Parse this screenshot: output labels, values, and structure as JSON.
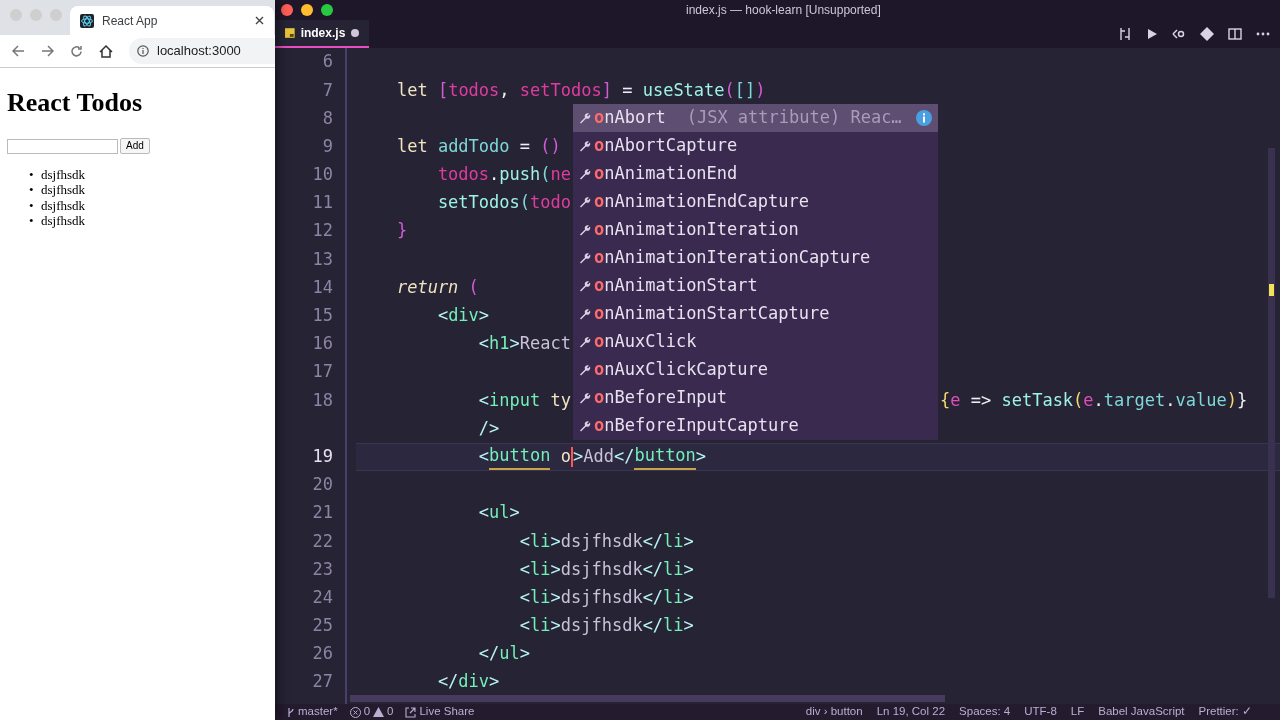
{
  "browser": {
    "tab": {
      "title": "React App"
    },
    "address": "localhost:3000",
    "page": {
      "heading": "React Todos",
      "add_button": "Add",
      "items": [
        {
          "marker": "•",
          "text": "dsjfhsdk"
        },
        {
          "marker": "•",
          "text": "dsjfhsdk"
        },
        {
          "marker": "•",
          "text": "dsjfhsdk"
        },
        {
          "marker": "•",
          "text": "dsjfhsdk"
        }
      ]
    }
  },
  "editor": {
    "title": "index.js — hook-learn [Unsupported]",
    "tabs": [
      {
        "label": "index.js",
        "selected": true,
        "dirty": true
      }
    ],
    "lines": [
      {
        "num": "6",
        "current": false
      },
      {
        "num": "7",
        "current": false,
        "tokens": [
          {
            "kind": "kw",
            "s": "    let "
          },
          {
            "kind": "br",
            "s": "["
          },
          {
            "kind": "var",
            "s": "todos"
          },
          {
            "kind": "op",
            "s": ", "
          },
          {
            "kind": "var",
            "s": "setTodos"
          },
          {
            "kind": "br",
            "s": "]"
          },
          {
            "kind": "op",
            "s": " = "
          },
          {
            "kind": "fn",
            "s": "useState"
          },
          {
            "kind": "br",
            "s": "("
          },
          {
            "kind": "prop",
            "s": "[]"
          },
          {
            "kind": "br",
            "s": ")"
          }
        ]
      },
      {
        "num": "8",
        "current": false
      },
      {
        "num": "9",
        "current": false,
        "tokens": [
          {
            "kind": "kw",
            "s": "    let "
          },
          {
            "kind": "prop",
            "s": "addTodo"
          },
          {
            "kind": "op",
            "s": " = "
          },
          {
            "kind": "br",
            "s": "()"
          }
        ]
      },
      {
        "num": "10",
        "current": false,
        "tokens": [
          {
            "kind": "var",
            "s": "        todos"
          },
          {
            "kind": "op",
            "s": "."
          },
          {
            "kind": "fn",
            "s": "push"
          },
          {
            "kind": "prop",
            "s": "("
          },
          {
            "kind": "var",
            "s": "ne"
          }
        ]
      },
      {
        "num": "11",
        "current": false,
        "tokens": [
          {
            "kind": "fn",
            "s": "        setTodos"
          },
          {
            "kind": "prop",
            "s": "("
          },
          {
            "kind": "var",
            "s": "todo"
          }
        ]
      },
      {
        "num": "12",
        "current": false,
        "tokens": [
          {
            "kind": "br",
            "s": "    }"
          }
        ]
      },
      {
        "num": "13",
        "current": false
      },
      {
        "num": "14",
        "current": false,
        "tokens": [
          {
            "kind": "ret",
            "s": "    return "
          },
          {
            "kind": "br",
            "s": "("
          }
        ]
      },
      {
        "num": "15",
        "current": false,
        "tokens": [
          {
            "kind": "tp",
            "s": "        <"
          },
          {
            "kind": "tag",
            "s": "div"
          },
          {
            "kind": "tp",
            "s": ">"
          }
        ]
      },
      {
        "num": "16",
        "current": false,
        "tokens": [
          {
            "kind": "tp",
            "s": "            <"
          },
          {
            "kind": "tag",
            "s": "h1"
          },
          {
            "kind": "tp",
            "s": ">"
          },
          {
            "kind": "text",
            "s": "React"
          }
        ]
      },
      {
        "num": "17",
        "current": false
      },
      {
        "num": "18",
        "current": false,
        "tokens": [
          {
            "kind": "tp",
            "s": "            <"
          },
          {
            "kind": "tag",
            "s": "input"
          },
          {
            "kind": "kw",
            "s": " ty"
          }
        ],
        "after": [
          {
            "kind": "ye",
            "s": "{"
          },
          {
            "kind": "par",
            "s": "e"
          },
          {
            "kind": "op",
            "s": " => "
          },
          {
            "kind": "fn",
            "s": "setTask"
          },
          {
            "kind": "ye",
            "s": "("
          },
          {
            "kind": "par",
            "s": "e"
          },
          {
            "kind": "op",
            "s": "."
          },
          {
            "kind": "prop",
            "s": "target"
          },
          {
            "kind": "op",
            "s": "."
          },
          {
            "kind": "prop",
            "s": "value"
          },
          {
            "kind": "ye",
            "s": ")"
          },
          {
            "kind": "op",
            "s": "}"
          }
        ]
      },
      {
        "current": false,
        "tokens": [
          {
            "kind": "tp",
            "s": "            />"
          }
        ]
      },
      {
        "num": "19",
        "current": true,
        "tokens": [
          {
            "kind": "tp",
            "s": "            <"
          },
          {
            "kind": "match",
            "s": "button"
          },
          {
            "kind": "kw",
            "s": " o"
          },
          {
            "kind": "cursor"
          },
          {
            "kind": "tp",
            "s": ">"
          },
          {
            "kind": "text",
            "s": "Add"
          },
          {
            "kind": "tp",
            "s": "</"
          },
          {
            "kind": "match",
            "s": "button"
          },
          {
            "kind": "tp",
            "s": ">"
          }
        ]
      },
      {
        "num": "20",
        "current": false
      },
      {
        "num": "21",
        "current": false,
        "tokens": [
          {
            "kind": "tp",
            "s": "            <"
          },
          {
            "kind": "tag",
            "s": "ul"
          },
          {
            "kind": "tp",
            "s": ">"
          }
        ]
      },
      {
        "num": "22",
        "current": false,
        "tokens": [
          {
            "kind": "tp",
            "s": "                <"
          },
          {
            "kind": "tag",
            "s": "li"
          },
          {
            "kind": "tp",
            "s": ">"
          },
          {
            "kind": "text",
            "s": "dsjfhsdk"
          },
          {
            "kind": "tp",
            "s": "</"
          },
          {
            "kind": "tag",
            "s": "li"
          },
          {
            "kind": "tp",
            "s": ">"
          }
        ]
      },
      {
        "num": "23",
        "current": false,
        "tokens": [
          {
            "kind": "tp",
            "s": "                <"
          },
          {
            "kind": "tag",
            "s": "li"
          },
          {
            "kind": "tp",
            "s": ">"
          },
          {
            "kind": "text",
            "s": "dsjfhsdk"
          },
          {
            "kind": "tp",
            "s": "</"
          },
          {
            "kind": "tag",
            "s": "li"
          },
          {
            "kind": "tp",
            "s": ">"
          }
        ]
      },
      {
        "num": "24",
        "current": false,
        "tokens": [
          {
            "kind": "tp",
            "s": "                <"
          },
          {
            "kind": "tag",
            "s": "li"
          },
          {
            "kind": "tp",
            "s": ">"
          },
          {
            "kind": "text",
            "s": "dsjfhsdk"
          },
          {
            "kind": "tp",
            "s": "</"
          },
          {
            "kind": "tag",
            "s": "li"
          },
          {
            "kind": "tp",
            "s": ">"
          }
        ]
      },
      {
        "num": "25",
        "current": false,
        "tokens": [
          {
            "kind": "tp",
            "s": "                <"
          },
          {
            "kind": "tag",
            "s": "li"
          },
          {
            "kind": "tp",
            "s": ">"
          },
          {
            "kind": "text",
            "s": "dsjfhsdk"
          },
          {
            "kind": "tp",
            "s": "</"
          },
          {
            "kind": "tag",
            "s": "li"
          },
          {
            "kind": "tp",
            "s": ">"
          }
        ]
      },
      {
        "num": "26",
        "current": false,
        "tokens": [
          {
            "kind": "tp",
            "s": "            </"
          },
          {
            "kind": "tag",
            "s": "ul"
          },
          {
            "kind": "tp",
            "s": ">"
          }
        ]
      },
      {
        "num": "27",
        "current": false,
        "tokens": [
          {
            "kind": "tp",
            "s": "        </"
          },
          {
            "kind": "tag",
            "s": "div"
          },
          {
            "kind": "tp",
            "s": ">"
          }
        ]
      }
    ],
    "suggestions": [
      {
        "match": "o",
        "rest": "nAbort",
        "detail": "(JSX attribute) Reac…",
        "selected": true
      },
      {
        "match": "o",
        "rest": "nAbortCapture",
        "selected": false
      },
      {
        "match": "o",
        "rest": "nAnimationEnd",
        "selected": false
      },
      {
        "match": "o",
        "rest": "nAnimationEndCapture",
        "selected": false
      },
      {
        "match": "o",
        "rest": "nAnimationIteration",
        "selected": false
      },
      {
        "match": "o",
        "rest": "nAnimationIterationCapture",
        "selected": false
      },
      {
        "match": "o",
        "rest": "nAnimationStart",
        "selected": false
      },
      {
        "match": "o",
        "rest": "nAnimationStartCapture",
        "selected": false
      },
      {
        "match": "o",
        "rest": "nAuxClick",
        "selected": false
      },
      {
        "match": "o",
        "rest": "nAuxClickCapture",
        "selected": false
      },
      {
        "match": "o",
        "rest": "nBeforeInput",
        "selected": false
      },
      {
        "match": "o",
        "rest": "nBeforeInputCapture",
        "selected": false
      }
    ],
    "status_bar": {
      "branch": "master*",
      "errors": "0",
      "warnings": "0",
      "live_share": "Live Share",
      "right": [
        "div › button",
        "Ln 19, Col 22",
        "Spaces: 4",
        "UTF-8",
        "LF",
        "Babel JavaScript",
        "Prettier: ✓"
      ]
    }
  }
}
